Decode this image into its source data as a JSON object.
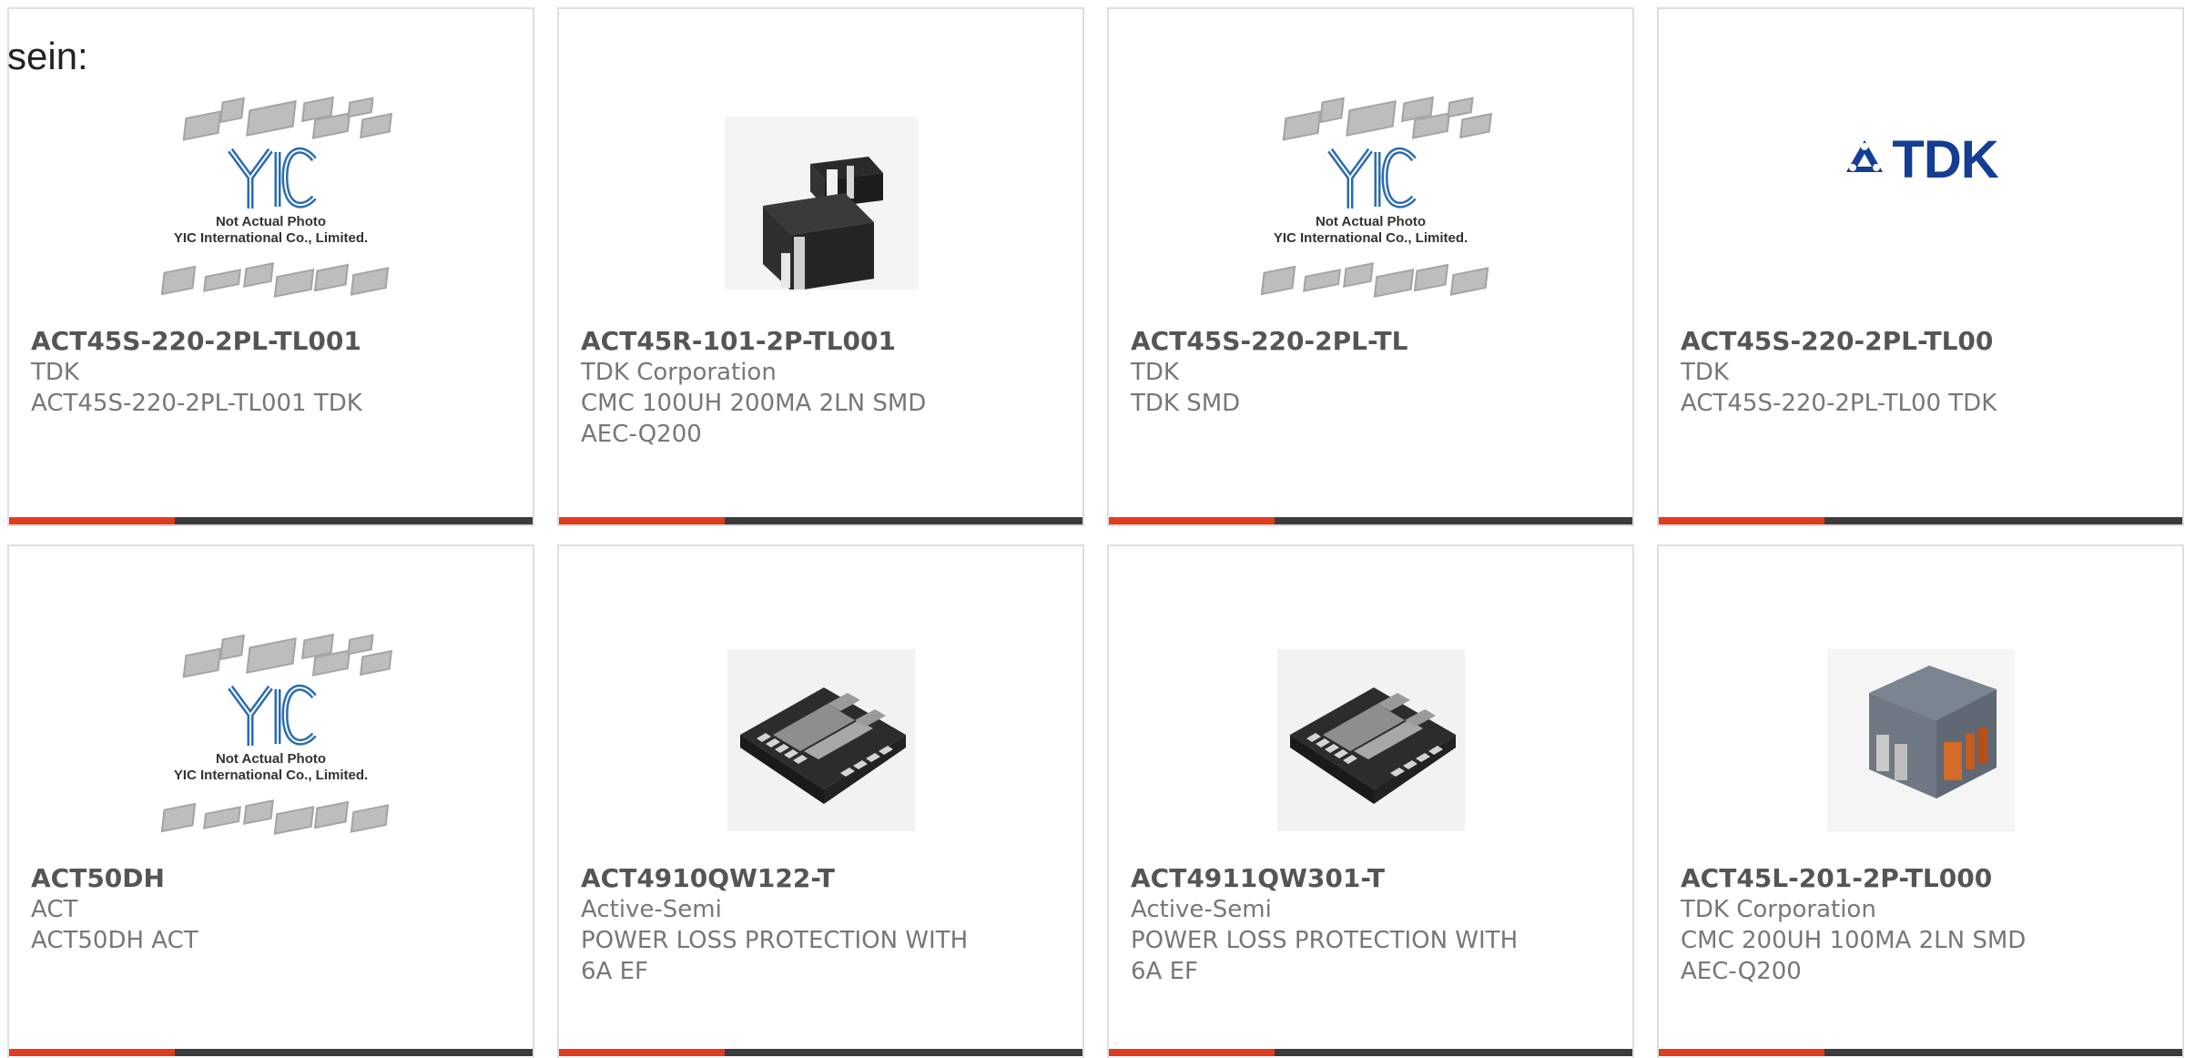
{
  "intro": {
    "text": "sein:"
  },
  "products": [
    {
      "part_number": "ACT45S-220-2PL-TL001",
      "manufacturer": "TDK",
      "description": "ACT45S-220-2PL-TL001 TDK",
      "image_type": "yic-placeholder",
      "image_caption_line1": "Not Actual Photo",
      "image_caption_line2": "YIC International Co., Limited."
    },
    {
      "part_number": "ACT45R-101-2P-TL001",
      "manufacturer": "TDK Corporation",
      "description": "CMC 100UH 200MA 2LN SMD AEC-Q200",
      "image_type": "dark-inductor-photo"
    },
    {
      "part_number": "ACT45S-220-2PL-TL",
      "manufacturer": "TDK",
      "description": "TDK SMD",
      "image_type": "yic-placeholder",
      "image_caption_line1": "Not Actual Photo",
      "image_caption_line2": "YIC International Co., Limited."
    },
    {
      "part_number": "ACT45S-220-2PL-TL00",
      "manufacturer": "TDK",
      "description": "ACT45S-220-2PL-TL00 TDK",
      "image_type": "tdk-logo",
      "logo_text": "TDK"
    },
    {
      "part_number": "ACT50DH",
      "manufacturer": "ACT",
      "description": "ACT50DH ACT",
      "image_type": "yic-placeholder",
      "image_caption_line1": "Not Actual Photo",
      "image_caption_line2": "YIC International Co., Limited."
    },
    {
      "part_number": "ACT4910QW122-T",
      "manufacturer": "Active-Semi",
      "description": "POWER LOSS PROTECTION WITH 6A EF",
      "image_type": "qfn-chip-photo"
    },
    {
      "part_number": "ACT4911QW301-T",
      "manufacturer": "Active-Semi",
      "description": "POWER LOSS PROTECTION WITH 6A EF",
      "image_type": "qfn-chip-photo"
    },
    {
      "part_number": "ACT45L-201-2P-TL000",
      "manufacturer": "TDK Corporation",
      "description": "CMC 200UH 100MA 2LN SMD AEC-Q200",
      "image_type": "gray-inductor-photo"
    }
  ],
  "colors": {
    "accent": "#e03c1f",
    "bar": "#3b3b3b",
    "border": "#dedede",
    "tdk_blue": "#143d94"
  }
}
